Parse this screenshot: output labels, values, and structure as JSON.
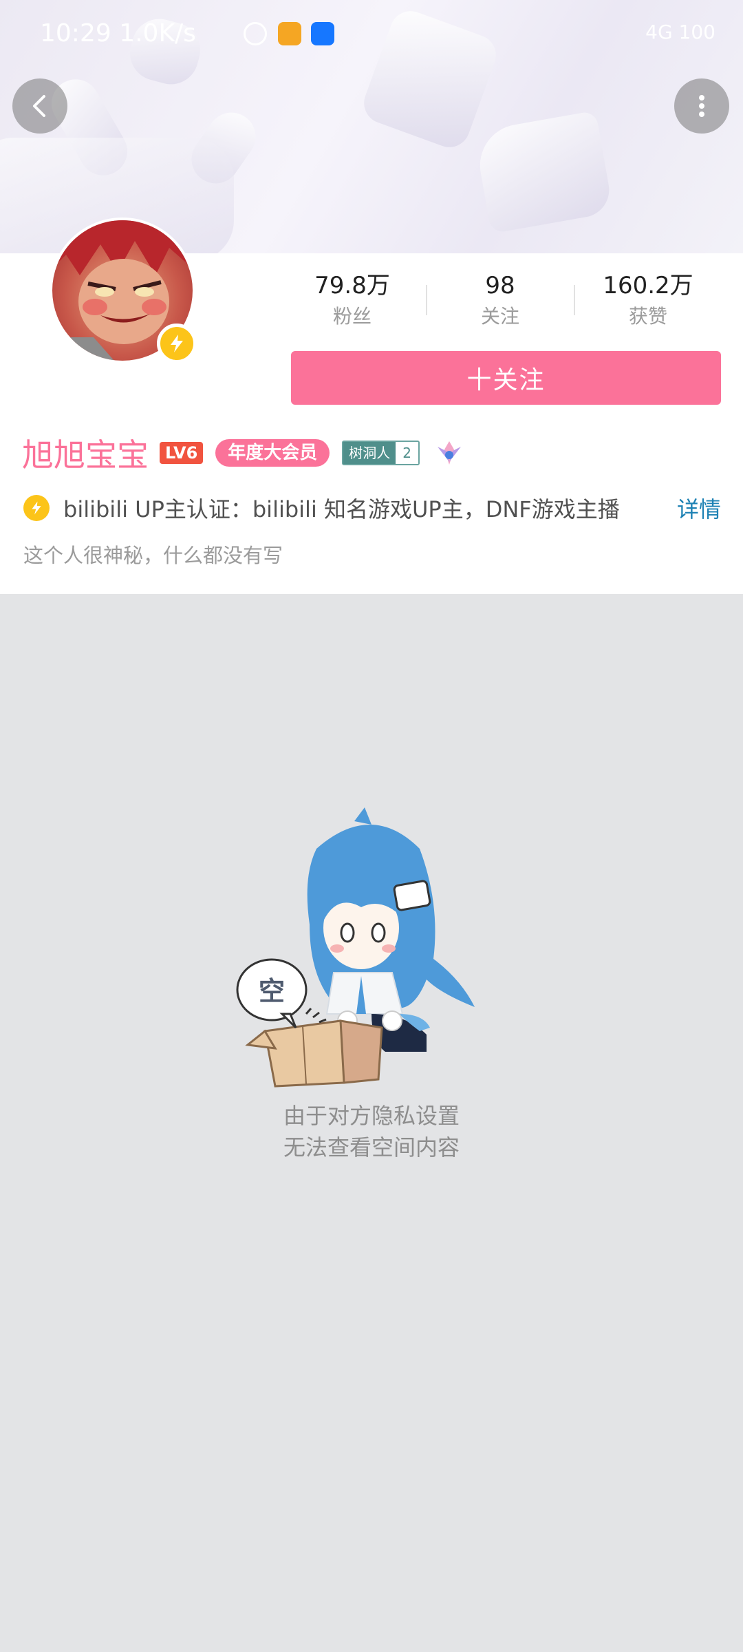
{
  "status_bar": {
    "time": "10:29 1.0K/s",
    "network": "4G 100"
  },
  "header": {
    "back_icon": "chevron-left-icon",
    "more_icon": "more-vertical-icon"
  },
  "profile": {
    "stats": [
      {
        "value": "79.8万",
        "label": "粉丝"
      },
      {
        "value": "98",
        "label": "关注"
      },
      {
        "value": "160.2万",
        "label": "获赞"
      }
    ],
    "follow_button": "十关注",
    "username": "旭旭宝宝",
    "level": "LV6",
    "vip_badge": "年度大会员",
    "shudong_label": "树洞人",
    "shudong_level": "2",
    "certification": "bilibili UP主认证：bilibili 知名游戏UP主，DNF游戏主播",
    "detail_link": "详情",
    "signature": "这个人很神秘，什么都没有写"
  },
  "empty_state": {
    "bubble_text": "空",
    "line1": "由于对方隐私设置",
    "line2": "无法查看空间内容"
  },
  "colors": {
    "accent": "#fb7299",
    "verify": "#fcc419",
    "link": "#1e82b4",
    "background": "#e3e4e6"
  }
}
